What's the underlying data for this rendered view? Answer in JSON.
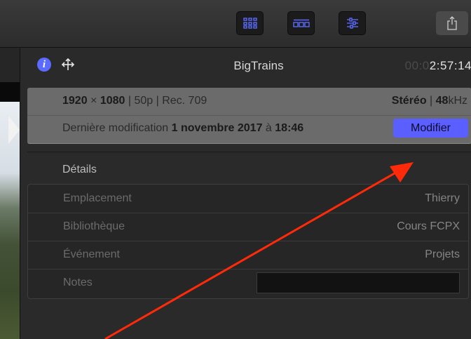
{
  "toolbar": {
    "buttons": [
      "grid-icon",
      "filmstrip-icon",
      "sliders-icon",
      "share-icon"
    ]
  },
  "inspector": {
    "title": "BigTrains",
    "timecode_dim": "00:0",
    "timecode": "2:57:14",
    "meta": {
      "resolution": "1920",
      "times": " × ",
      "resolution_h": "1080",
      "format_rest": " | 50p | Rec. 709",
      "audio_channels": "Stéréo",
      "audio_sep": " | ",
      "sample_rate": "48",
      "sample_unit": "kHz",
      "modified_label": "Dernière modification ",
      "modified_date": "1 novembre 2017",
      "modified_at": " à ",
      "modified_time": "18:46",
      "modify_button": "Modifier"
    },
    "details": {
      "heading": "Détails",
      "rows": [
        {
          "label": "Emplacement",
          "value": "Thierry"
        },
        {
          "label": "Bibliothèque",
          "value": "Cours FCPX"
        },
        {
          "label": "Événement",
          "value": "Projets"
        },
        {
          "label": "Notes",
          "value": ""
        }
      ]
    }
  },
  "colors": {
    "accent": "#5c5fff",
    "annotation_arrow": "#ff2a0a",
    "info_icon": "#5c6bff"
  }
}
